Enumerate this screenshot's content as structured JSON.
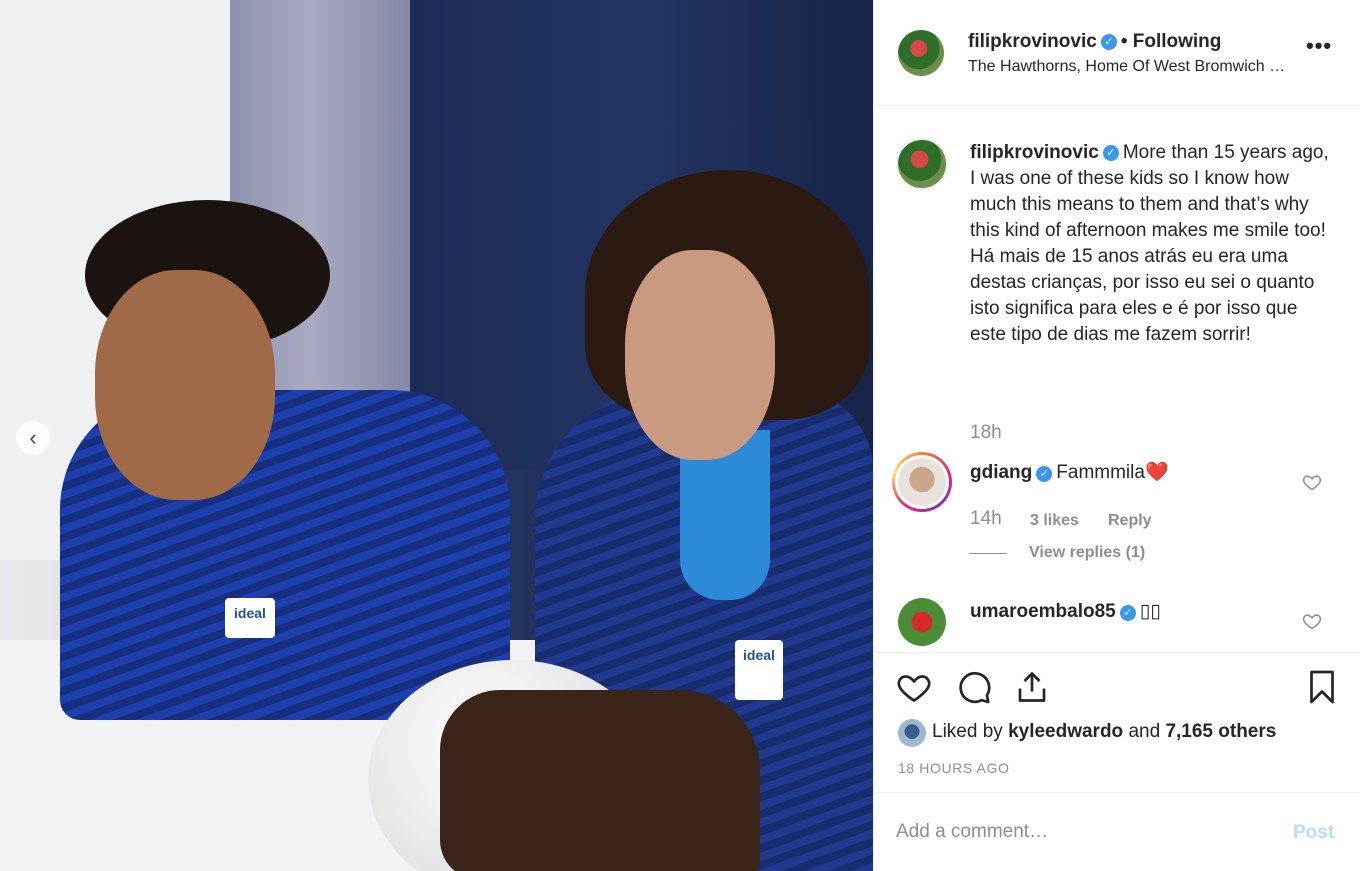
{
  "post": {
    "author": "filipkrovinovic",
    "follow_state": "• Following",
    "location": "The Hawthorns, Home Of West Bromwich …",
    "more_label": "•••"
  },
  "caption": {
    "author": "filipkrovinovic",
    "text": "More than 15 years ago, I was one of these kids so I know how much this means to them and that’s why this kind of afternoon makes me smile too!\nHá mais de 15 anos atrás eu era uma destas crianças, por isso eu sei o quanto isto significa para eles e é por isso que este tipo de dias me fazem sorrir!",
    "time": "18h"
  },
  "comments": [
    {
      "author": "gdiang",
      "text": "Fammmila❤️",
      "time": "14h",
      "likes": "3 likes",
      "reply_label": "Reply",
      "view_replies": "View replies (1)"
    },
    {
      "author": "umaroembalo85",
      "text": "▯▯"
    }
  ],
  "likes": {
    "prefix": "Liked by",
    "user": "kyleedwardo",
    "connector": "and",
    "others": "7,165 others"
  },
  "time_ago": "18 HOURS AGO",
  "add_comment": {
    "placeholder": "Add a comment…",
    "post_label": "Post"
  },
  "photo": {
    "prev_icon": "‹",
    "badge_text": "ideal"
  },
  "colors": {
    "verified": "#3897f0",
    "post_button_disabled": "#b2dffc",
    "secondary_text": "#8e8e8e"
  }
}
